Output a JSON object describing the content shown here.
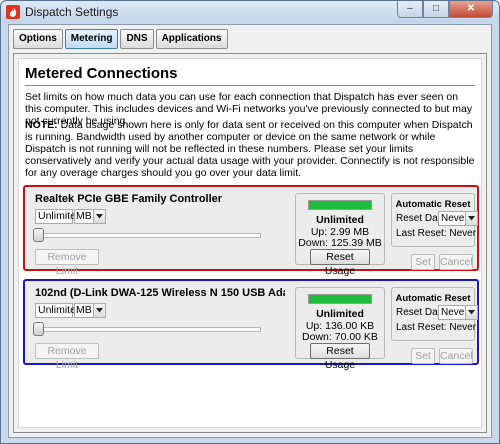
{
  "window": {
    "title": "Dispatch Settings",
    "minimize": "–",
    "maximize": "□",
    "close": "✕"
  },
  "tabs": [
    {
      "label": "Options",
      "active": false
    },
    {
      "label": "Metering",
      "active": true
    },
    {
      "label": "DNS",
      "active": false
    },
    {
      "label": "Applications",
      "active": false
    }
  ],
  "page": {
    "heading": "Metered Connections",
    "intro": "Set limits on how much data you can use for each connection that Dispatch has ever seen on this computer. This includes devices and Wi-Fi networks you've previously connected to but may not currently be using.",
    "note_label": "NOTE:",
    "note_text": " Data usage shown here is only for data sent or received on this computer when Dispatch is running. Bandwidth used by another computer or device on the same network or while Dispatch is not running will not be reflected in these numbers. Please set your limits conservatively and verify your actual data usage with your provider. Connectify is not responsible for any overage charges should you go over your data limit."
  },
  "connections": [
    {
      "name": "Realtek PCIe GBE Family Controller",
      "limit_value": "Unlimited",
      "unit": "MB",
      "slider_value": 0,
      "remove_label": "Remove Limit",
      "usage_fill": 1.0,
      "usage_title": "Unlimited",
      "up": "Up: 2.99 MB",
      "down": "Down: 125.39 MB",
      "reset_usage_label": "Reset Usage",
      "auto_reset_title": "Automatic Reset",
      "reset_day_label": "Reset Day:",
      "reset_day_value": "Never",
      "last_reset": "Last Reset: Never",
      "set_label": "Set",
      "cancel_label": "Cancel",
      "highlight_color": "#cc1111"
    },
    {
      "name": "102nd (D-Link DWA-125 Wireless N 150 USB Ada...",
      "limit_value": "Unlimited",
      "unit": "MB",
      "slider_value": 0,
      "remove_label": "Remove Limit",
      "usage_fill": 1.0,
      "usage_title": "Unlimited",
      "up": "Up: 136.00 KB",
      "down": "Down: 70.00 KB",
      "reset_usage_label": "Reset Usage",
      "auto_reset_title": "Automatic Reset",
      "reset_day_label": "Reset Day:",
      "reset_day_value": "Never",
      "last_reset": "Last Reset: Never",
      "set_label": "Set",
      "cancel_label": "Cancel",
      "highlight_color": "#1818c8"
    }
  ],
  "colors": {
    "usage_bar": "#1fbd3d"
  },
  "icons": {
    "app": "flame-icon",
    "dropdown": "chevron-down-icon"
  }
}
